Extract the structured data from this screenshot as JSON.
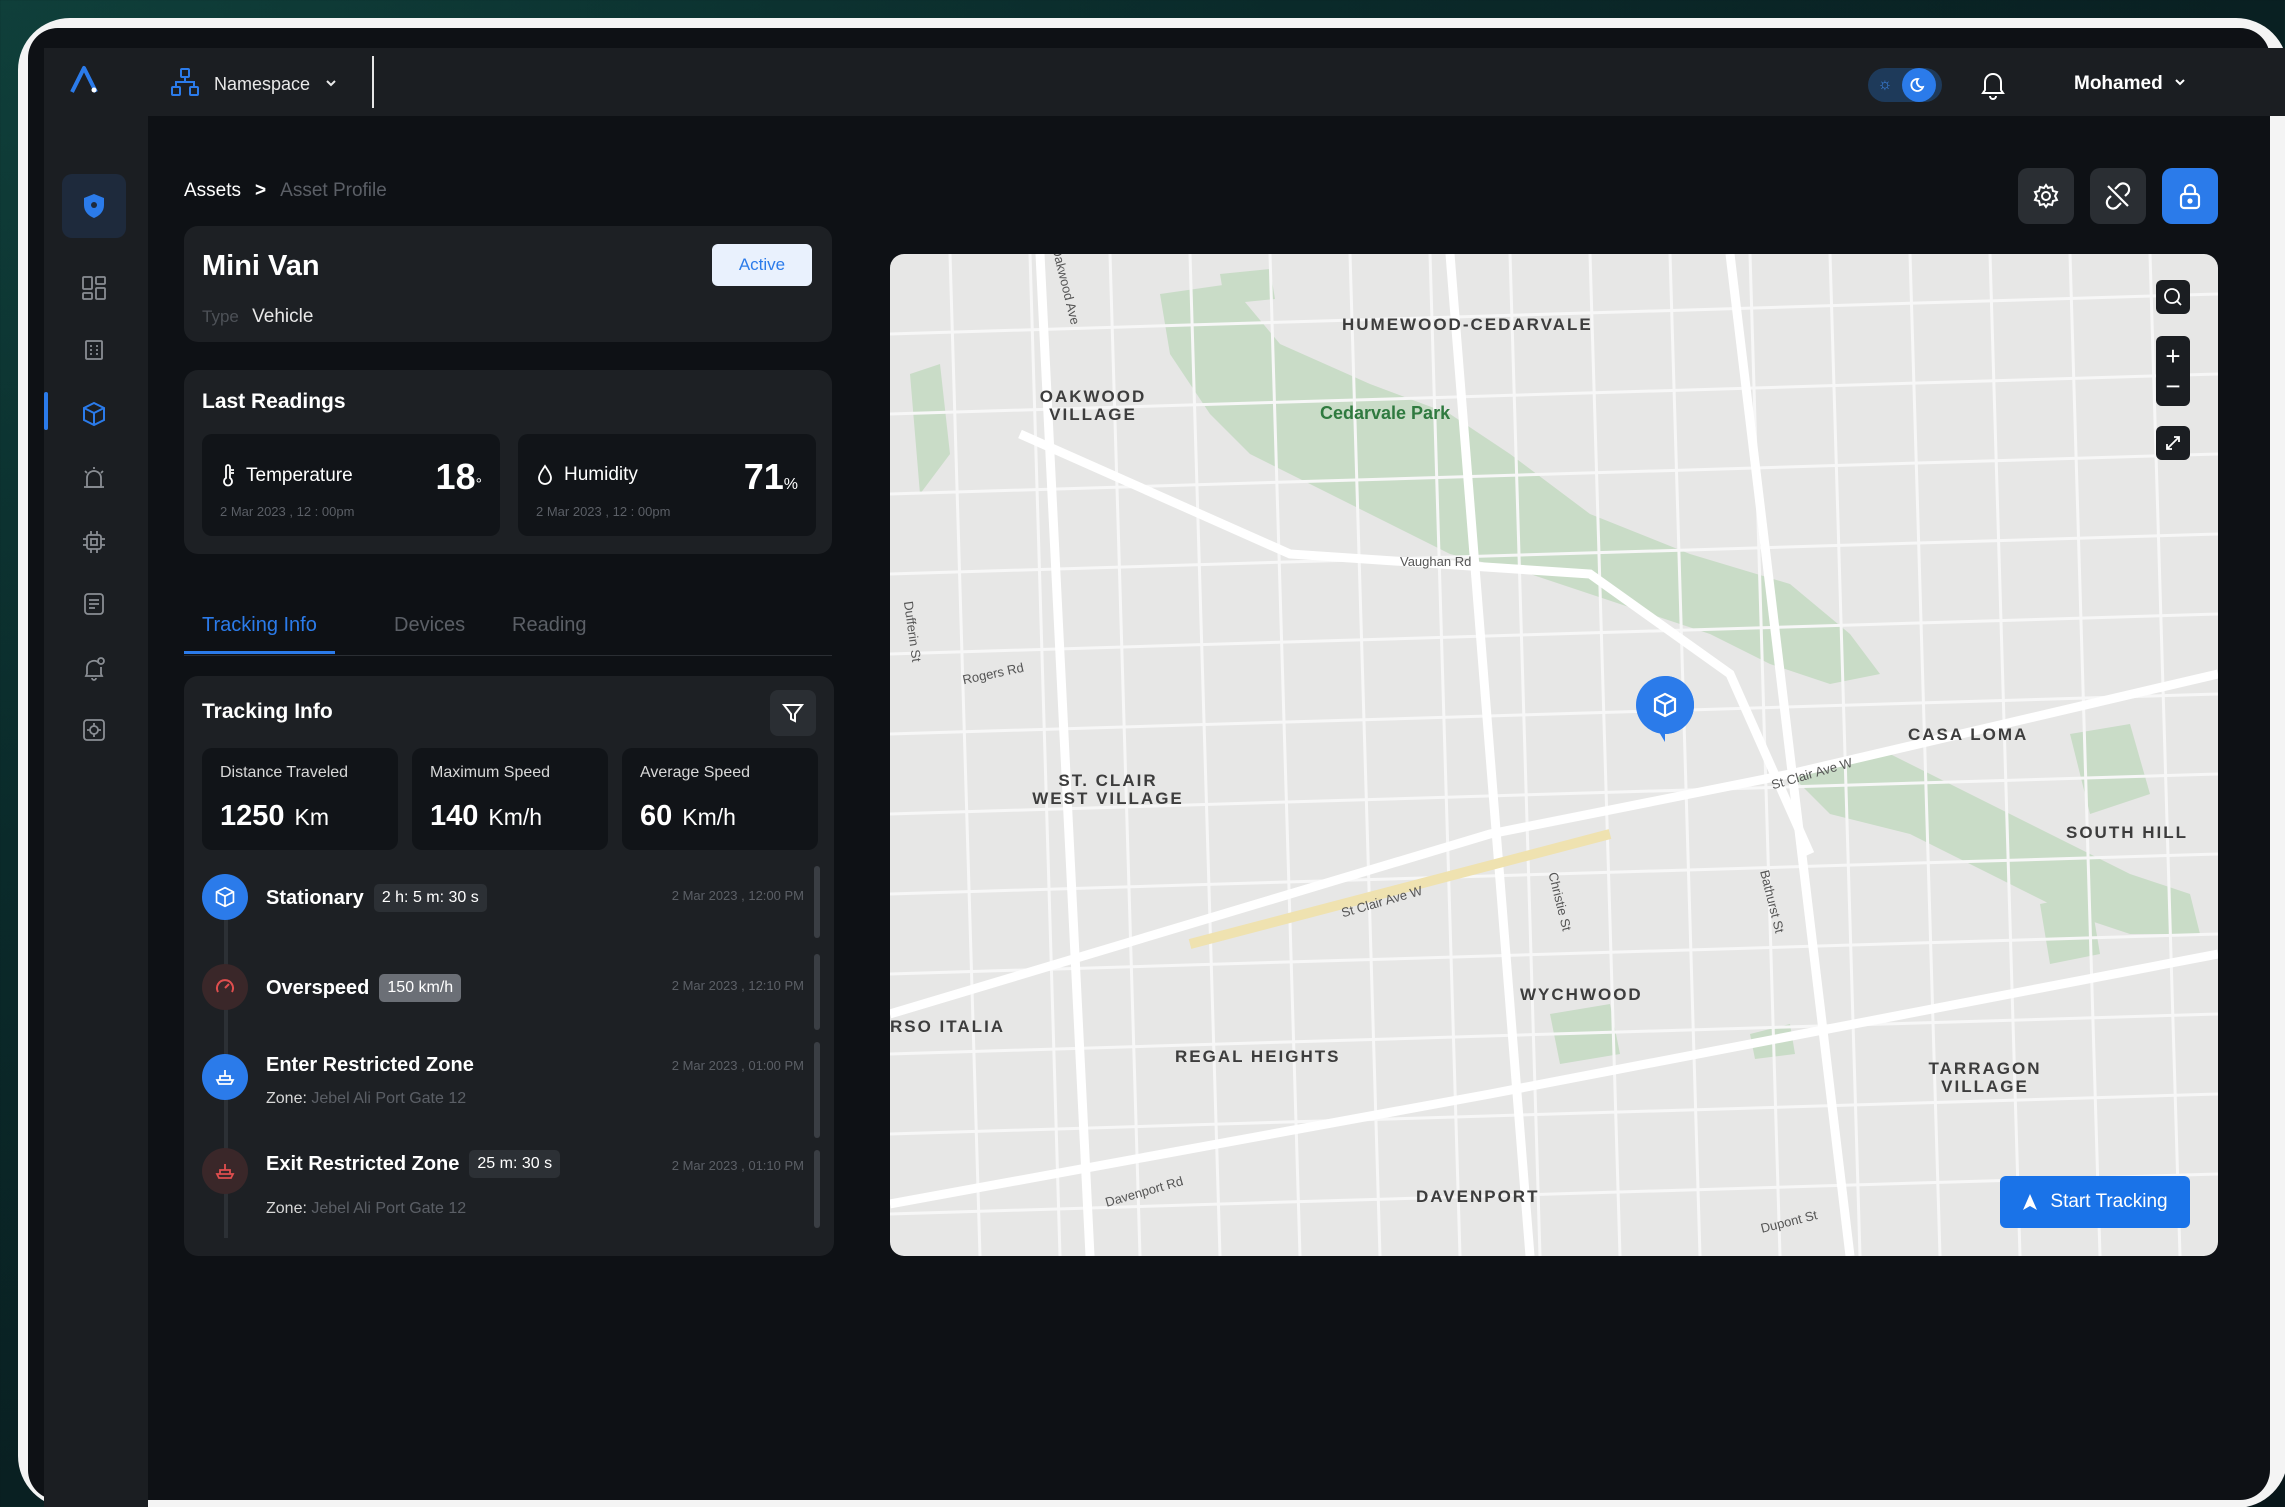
{
  "header": {
    "namespace_label": "Namespace",
    "user_name": "Mohamed"
  },
  "breadcrumb": {
    "root": "Assets",
    "separator": ">",
    "current": "Asset Profile"
  },
  "asset": {
    "name": "Mini Van",
    "type_label": "Type",
    "type_value": "Vehicle",
    "status": "Active"
  },
  "last_readings": {
    "title": "Last Readings",
    "items": [
      {
        "name": "Temperature",
        "value": "18",
        "unit": "°",
        "date": "2 Mar 2023 , 12 : 00pm",
        "icon": "thermometer-icon"
      },
      {
        "name": "Humidity",
        "value": "71",
        "unit": "%",
        "date": "2 Mar 2023 , 12 : 00pm",
        "icon": "droplet-icon"
      }
    ]
  },
  "tabs": [
    {
      "label": "Tracking Info",
      "active": true
    },
    {
      "label": "Devices",
      "active": false
    },
    {
      "label": "Reading",
      "active": false
    }
  ],
  "tracking": {
    "title": "Tracking Info",
    "stats": [
      {
        "label": "Distance Traveled",
        "value": "1250",
        "unit": "Km"
      },
      {
        "label": "Maximum Speed",
        "value": "140",
        "unit": "Km/h"
      },
      {
        "label": "Average Speed",
        "value": "60",
        "unit": "Km/h"
      }
    ],
    "events": [
      {
        "title": "Stationary",
        "pill": "2 h: 5 m: 30 s",
        "zone_label": "",
        "zone_value": "",
        "date": "2 Mar 2023 , 12:00 PM",
        "icon": "cube-icon"
      },
      {
        "title": "Overspeed",
        "pill": "150 km/h",
        "zone_label": "",
        "zone_value": "",
        "date": "2 Mar 2023 , 12:10 PM",
        "icon": "speedometer-icon"
      },
      {
        "title": "Enter Restricted Zone",
        "pill": "",
        "zone_label": "Zone:",
        "zone_value": "Jebel Ali  Port Gate 12",
        "date": "2 Mar 2023 , 01:00 PM",
        "icon": "ship-icon"
      },
      {
        "title": "Exit Restricted Zone",
        "pill": "25 m: 30 s",
        "zone_label": "Zone:",
        "zone_value": "Jebel Ali  Port Gate 12",
        "date": "2 Mar 2023 , 01:10 PM",
        "icon": "ship-icon"
      }
    ]
  },
  "map": {
    "areas": [
      "HUMEWOOD-CEDARVALE",
      "OAKWOOD VILLAGE",
      "ST. CLAIR WEST VILLAGE",
      "CASA LOMA",
      "SOUTH HILL",
      "WYCHWOOD",
      "REGAL HEIGHTS",
      "TARRAGON VILLAGE",
      "DAVENPORT",
      "RSO ITALIA"
    ],
    "park": "Cedarvale Park",
    "streets": [
      "Vaughan Rd",
      "Rogers Rd",
      "St Clair Ave W",
      "St Clair Ave W",
      "Davenport Rd",
      "Dupont St",
      "Bathurst St",
      "Christie St",
      "Dufferin St",
      "Oakwood Ave"
    ],
    "start_tracking_label": "Start Tracking",
    "zoom_in": "+",
    "zoom_out": "−"
  },
  "colors": {
    "accent": "#2b7bea",
    "background": "#0e1115",
    "card": "#1d2024"
  }
}
